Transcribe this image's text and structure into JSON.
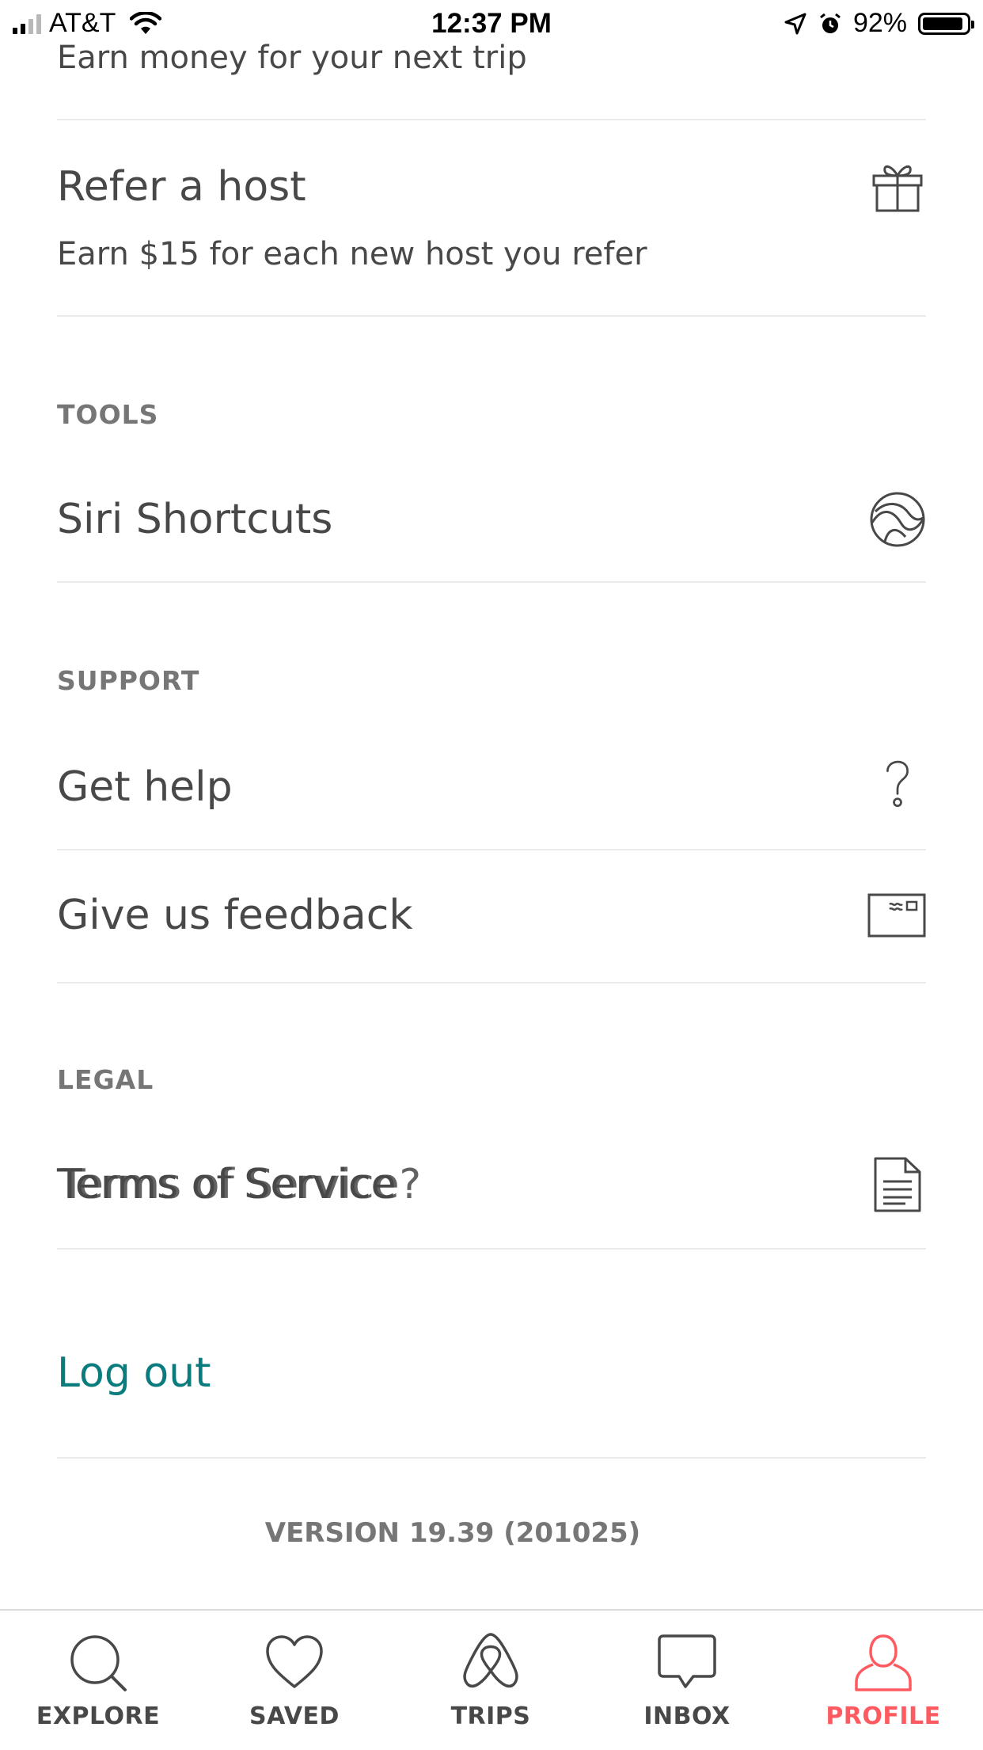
{
  "status_bar": {
    "carrier": "AT&T",
    "time": "12:37 PM",
    "battery": "92%",
    "battery_level": 0.92
  },
  "top_item": {
    "subtitle": "Earn money for your next trip"
  },
  "refer_host": {
    "title": "Refer a host",
    "subtitle": "Earn $15 for each new host you refer",
    "icon": "gift-icon"
  },
  "sections": {
    "tools_label": "TOOLS",
    "support_label": "SUPPORT",
    "legal_label": "LEGAL"
  },
  "items": {
    "siri": {
      "label": "Siri Shortcuts",
      "icon": "siri-icon"
    },
    "help": {
      "label": "Get help",
      "icon": "question-icon"
    },
    "feedback": {
      "label": "Give us feedback",
      "icon": "feedback-card-icon"
    },
    "terms": {
      "label": "Terms of Service",
      "ghost": "Terms of Service?",
      "icon": "document-icon"
    }
  },
  "logout_label": "Log out",
  "version": "VERSION 19.39 (201025)",
  "colors": {
    "accent_teal": "#0b7c7e",
    "active_tab": "#ff5a5f",
    "text": "#484848",
    "muted": "#767676"
  },
  "tabs": [
    {
      "label": "EXPLORE",
      "icon": "search-icon"
    },
    {
      "label": "SAVED",
      "icon": "heart-icon"
    },
    {
      "label": "TRIPS",
      "icon": "airbnb-logo-icon"
    },
    {
      "label": "INBOX",
      "icon": "chat-bubble-icon"
    },
    {
      "label": "PROFILE",
      "icon": "profile-icon",
      "active": true
    }
  ]
}
